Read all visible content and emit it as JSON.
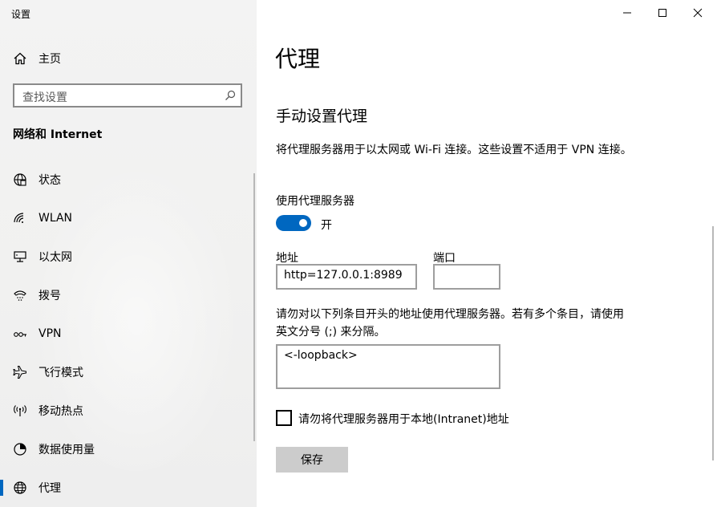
{
  "window": {
    "title": "设置",
    "controls": [
      "minimize-icon",
      "maximize-icon",
      "close-icon"
    ]
  },
  "sidebar": {
    "home_label": "主页",
    "search_placeholder": "查找设置",
    "section_title": "网络和 Internet",
    "items": [
      {
        "label": "状态",
        "icon": "globe-status-icon"
      },
      {
        "label": "WLAN",
        "icon": "wifi-icon"
      },
      {
        "label": "以太网",
        "icon": "ethernet-icon"
      },
      {
        "label": "拨号",
        "icon": "dialup-icon"
      },
      {
        "label": "VPN",
        "icon": "vpn-icon"
      },
      {
        "label": "飞行模式",
        "icon": "airplane-icon"
      },
      {
        "label": "移动热点",
        "icon": "hotspot-icon"
      },
      {
        "label": "数据使用量",
        "icon": "data-usage-icon"
      },
      {
        "label": "代理",
        "icon": "globe-icon",
        "active": true
      }
    ]
  },
  "main": {
    "title": "代理",
    "subtitle": "手动设置代理",
    "description": "将代理服务器用于以太网或 Wi-Fi 连接。这些设置不适用于 VPN 连接。",
    "use_proxy_label": "使用代理服务器",
    "toggle_state": "开",
    "toggle_on": true,
    "address_label": "地址",
    "address_value": "http=127.0.0.1:8989",
    "port_label": "端口",
    "port_value": "",
    "exceptions_label": "请勿对以下列条目开头的地址使用代理服务器。若有多个条目，请使用英文分号 (;) 来分隔。",
    "exceptions_value": "<-loopback>",
    "local_checkbox_label": "请勿将代理服务器用于本地(Intranet)地址",
    "local_checkbox_checked": false,
    "save_label": "保存"
  },
  "colors": {
    "accent": "#0067c0",
    "sidebar_bg": "#f2f2f2",
    "button_bg": "#cccccc"
  }
}
